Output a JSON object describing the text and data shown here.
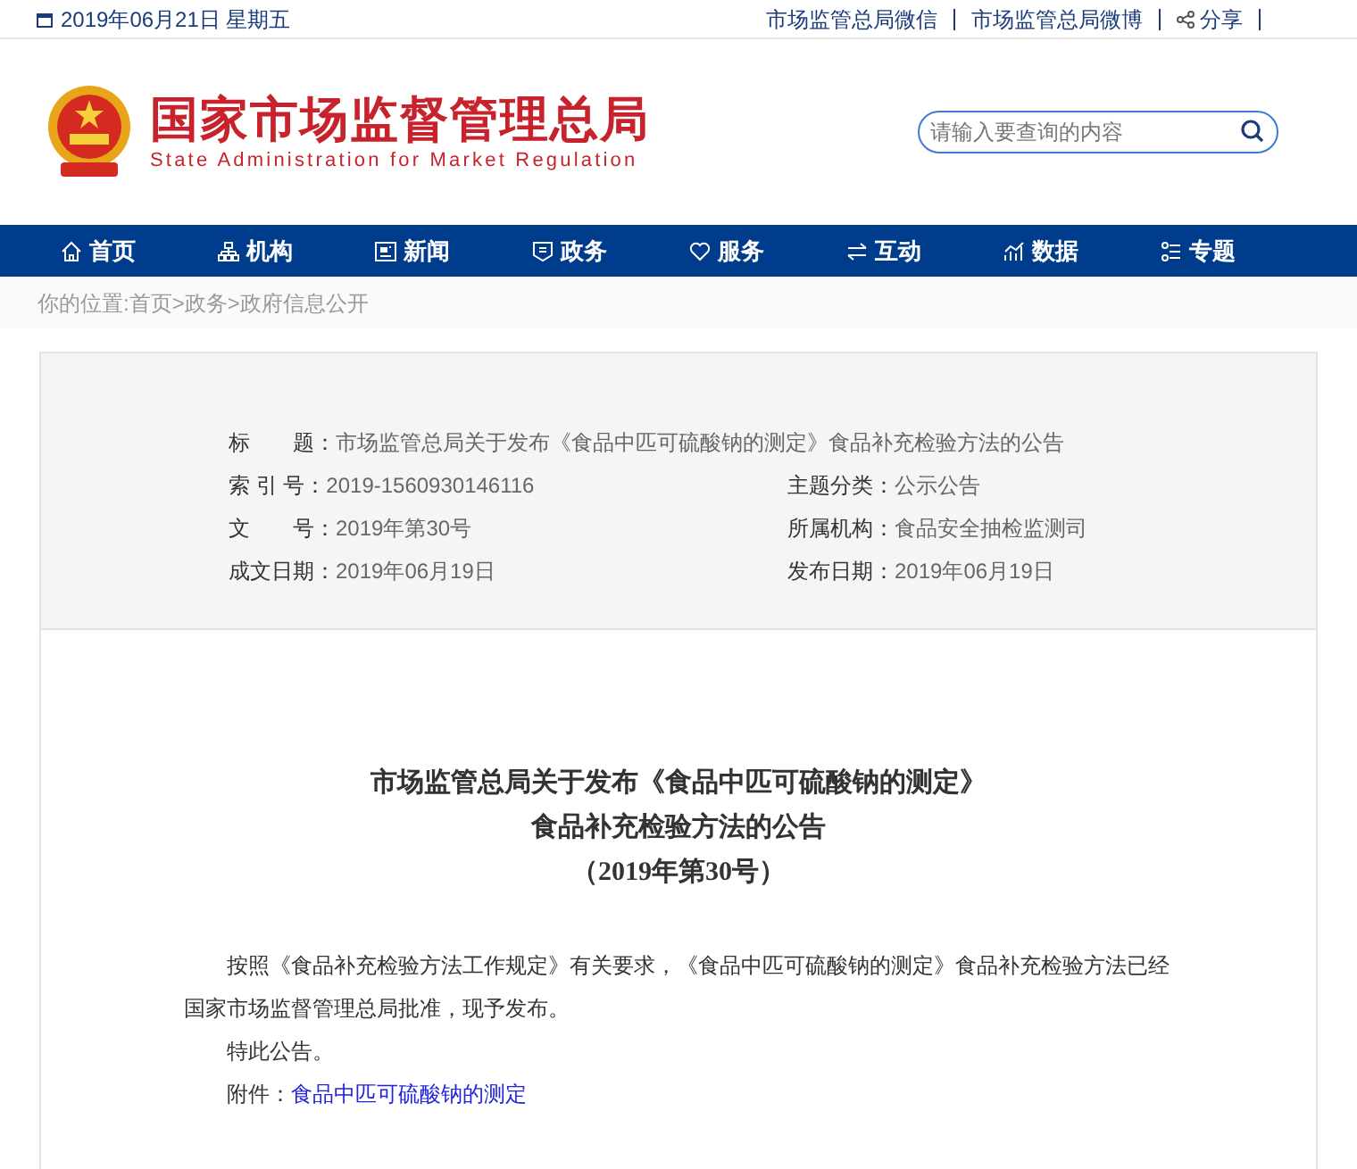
{
  "top_bar": {
    "date": "2019年06月21日 星期五",
    "links": [
      "市场监管总局微信",
      "市场监管总局微博",
      "分享"
    ]
  },
  "header": {
    "title": "国家市场监督管理总局",
    "subtitle": "State Administration for Market Regulation",
    "search": {
      "placeholder": "请输入要查询的内容"
    }
  },
  "nav": [
    {
      "label": "首页"
    },
    {
      "label": "机构"
    },
    {
      "label": "新闻"
    },
    {
      "label": "政务"
    },
    {
      "label": "服务"
    },
    {
      "label": "互动"
    },
    {
      "label": "数据"
    },
    {
      "label": "专题"
    }
  ],
  "breadcrumb": {
    "label": "你的位置:",
    "separator": ">",
    "items": [
      "首页",
      "政务",
      "政府信息公开"
    ]
  },
  "meta": {
    "title": {
      "label": "标　　题：",
      "value": "市场监管总局关于发布《食品中匹可硫酸钠的测定》食品补充检验方法的公告"
    },
    "rows": [
      [
        {
          "label": "索 引 号：",
          "value": "2019-1560930146116"
        },
        {
          "label": "主题分类：",
          "value": "公示公告"
        }
      ],
      [
        {
          "label": "文　　号：",
          "value": "2019年第30号"
        },
        {
          "label": "所属机构：",
          "value": "食品安全抽检监测司"
        }
      ],
      [
        {
          "label": "成文日期：",
          "value": "2019年06月19日"
        },
        {
          "label": "发布日期：",
          "value": "2019年06月19日"
        }
      ]
    ]
  },
  "article": {
    "heading": [
      "市场监管总局关于发布《食品中匹可硫酸钠的测定》",
      "食品补充检验方法的公告",
      "（2019年第30号）"
    ],
    "paragraphs": [
      "按照《食品补充检验方法工作规定》有关要求，《食品中匹可硫酸钠的测定》食品补充检验方法已经国家市场监督管理总局批准，现予发布。",
      "特此公告。"
    ],
    "attachment": {
      "label": "附件：",
      "link": "食品中匹可硫酸钠的测定"
    }
  }
}
